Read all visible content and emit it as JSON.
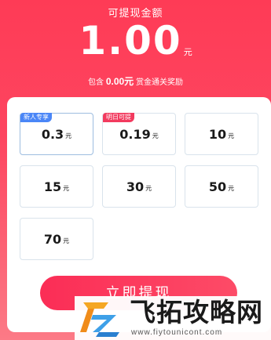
{
  "header": {
    "label": "可提现金额",
    "amount": "1.00",
    "unit": "元",
    "sub_prefix": "包含",
    "sub_amount": "0.00元",
    "sub_suffix": "赏金通关奖励"
  },
  "options": [
    {
      "value": "0.3",
      "unit": "元",
      "tag": "新人专享",
      "tag_color": "#4a86f7"
    },
    {
      "value": "0.19",
      "unit": "元",
      "tag": "明日可提",
      "tag_color": "#f23a5e"
    },
    {
      "value": "10",
      "unit": "元"
    },
    {
      "value": "15",
      "unit": "元"
    },
    {
      "value": "30",
      "unit": "元"
    },
    {
      "value": "50",
      "unit": "元"
    },
    {
      "value": "70",
      "unit": "元"
    }
  ],
  "action": {
    "withdraw_label": "立即提现"
  },
  "watermark": {
    "title": "飞拓攻略网",
    "url": "www.fiytounicont.com"
  },
  "colors": {
    "primary": "#fe3b56",
    "tag_blue": "#4a86f7",
    "tag_pink": "#f23a5e"
  }
}
